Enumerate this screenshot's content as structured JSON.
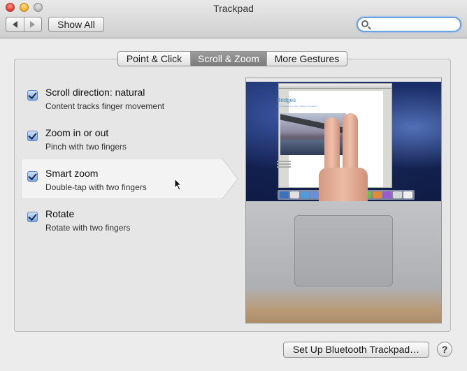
{
  "window": {
    "title": "Trackpad"
  },
  "toolbar": {
    "show_all_label": "Show All",
    "search_placeholder": ""
  },
  "tabs": [
    {
      "label": "Point & Click",
      "active": false
    },
    {
      "label": "Scroll & Zoom",
      "active": true
    },
    {
      "label": "More Gestures",
      "active": false
    }
  ],
  "options": [
    {
      "title": "Scroll direction: natural",
      "subtitle": "Content tracks finger movement",
      "checked": true,
      "selected": false
    },
    {
      "title": "Zoom in or out",
      "subtitle": "Pinch with two fingers",
      "checked": true,
      "selected": false
    },
    {
      "title": "Smart zoom",
      "subtitle": "Double-tap with two fingers",
      "checked": true,
      "selected": true
    },
    {
      "title": "Rotate",
      "subtitle": "Rotate with two fingers",
      "checked": true,
      "selected": false
    }
  ],
  "preview": {
    "doc_title": "Bridges",
    "doc_subtitle": "An introduction to man's boldest innovation"
  },
  "footer": {
    "bluetooth_button_label": "Set Up Bluetooth Trackpad…",
    "help_label": "?"
  },
  "colors": {
    "active_tab": "#8a8a8a",
    "checkbox": "#7ea7e0",
    "search_focus": "#6aa0e6",
    "dock_icons": [
      "#3b6fc0",
      "#e0e0e0",
      "#4f9be0",
      "#6a8fd8",
      "#d0d0d0",
      "#e8c24a",
      "#4aa0d8",
      "#c94a3a",
      "#6cc04a",
      "#e08a3a",
      "#9a5ad0",
      "#d8d8d8",
      "#f0f0f0"
    ]
  }
}
